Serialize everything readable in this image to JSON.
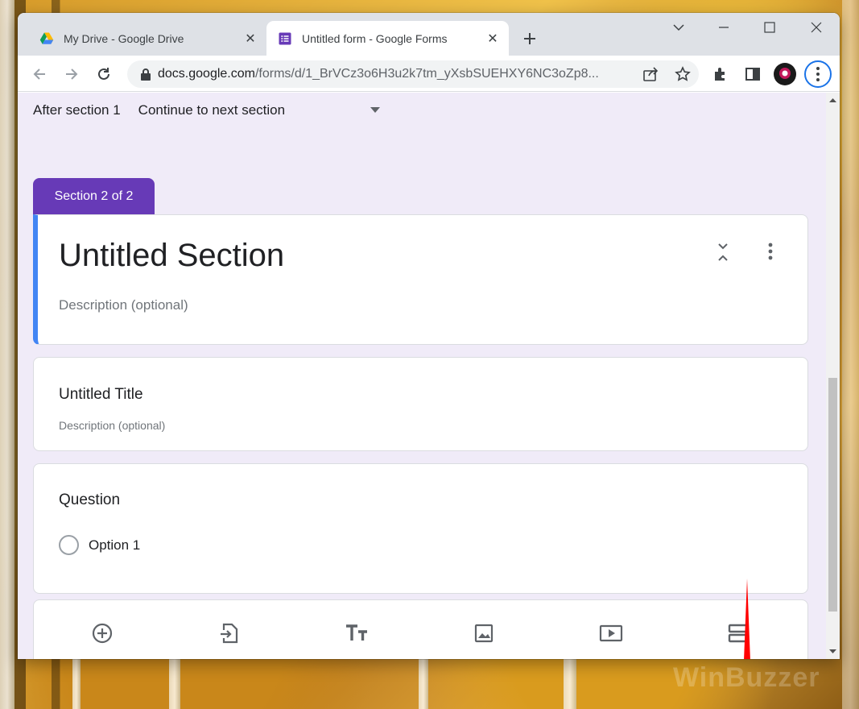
{
  "browser": {
    "tabs": [
      {
        "label": "My Drive - Google Drive",
        "active": false,
        "icon": "google-drive-icon"
      },
      {
        "label": "Untitled form - Google Forms",
        "active": true,
        "icon": "google-forms-icon"
      }
    ],
    "url_host": "docs.google.com",
    "url_path": "/forms/d/1_BrVCz3o6H3u2k7tm_yXsbSUEHXY6NC3oZp8..."
  },
  "form": {
    "after_section_label": "After section 1",
    "after_section_value": "Continue to next section",
    "section_tab_label": "Section 2 of 2",
    "section_title": "Untitled Section",
    "section_description": "Description (optional)",
    "title_item_title": "Untitled Title",
    "title_item_description": "Description (optional)",
    "question_title": "Question",
    "question_options": [
      "Option 1"
    ]
  },
  "toolbar_icons": [
    "add-question-icon",
    "import-questions-icon",
    "add-title-icon",
    "add-image-icon",
    "add-video-icon",
    "add-section-icon"
  ],
  "colors": {
    "accent_purple": "#673ab7",
    "section_border_blue": "#4285f4",
    "form_background": "#f0ebf8",
    "annotation_arrow": "#ff0000"
  },
  "watermark": "WinBuzzer"
}
